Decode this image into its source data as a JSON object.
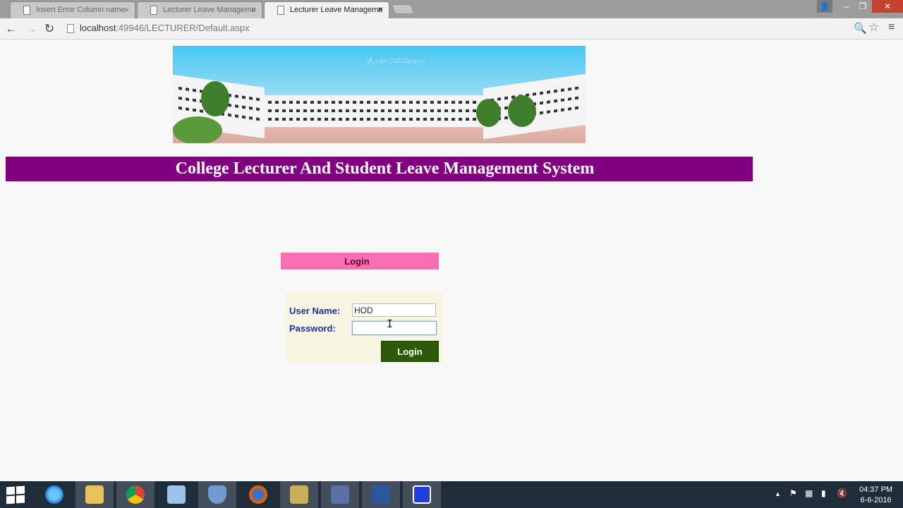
{
  "browser": {
    "tabs": [
      {
        "title": "Insert Error Column name",
        "active": false
      },
      {
        "title": "Lecturer Leave Manageme",
        "active": false
      },
      {
        "title": "Lecturer Leave Manageme",
        "active": true
      }
    ],
    "tab_close_glyph": "×",
    "window_controls": {
      "user": "👤",
      "minimize": "–",
      "maximize": "❐",
      "close": "✕"
    },
    "nav": {
      "back": "←",
      "forward": "→",
      "reload": "↻"
    },
    "url_host": "localhost",
    "url_rest": ":49946/LECTURER/Default.aspx",
    "toolbar_icons": {
      "zoom": "🔍",
      "star": "☆",
      "menu": "≡"
    }
  },
  "page": {
    "banner_caption": "ශ්‍රී ලංකා විශ්වවිද්‍යාලය",
    "title": "College Lecturer And Student Leave Management System",
    "login_header": "Login",
    "username_label": "User Name:",
    "username_value": "HOD",
    "password_label": "Password:",
    "password_value": "",
    "login_button": "Login",
    "cursor_glyph": "I"
  },
  "colors": {
    "title_bar": "#800080",
    "login_header": "#f76eb3",
    "login_button": "#2b5a08",
    "label_text": "#1f2fa0"
  },
  "taskbar": {
    "items": [
      "start-icon",
      "ie-icon",
      "file-explorer-icon",
      "chrome-icon",
      "app-cube-icon",
      "shield-app-icon",
      "firefox-icon",
      "tools-icon",
      "media-icon",
      "word-icon",
      "visual-studio-icon"
    ],
    "tray_icons": {
      "show_hidden": "▲",
      "flag": "⚑",
      "network": "▦",
      "signal": "▮",
      "volume": "🔇"
    },
    "time": "04:37 PM",
    "date": "6-6-2016"
  }
}
